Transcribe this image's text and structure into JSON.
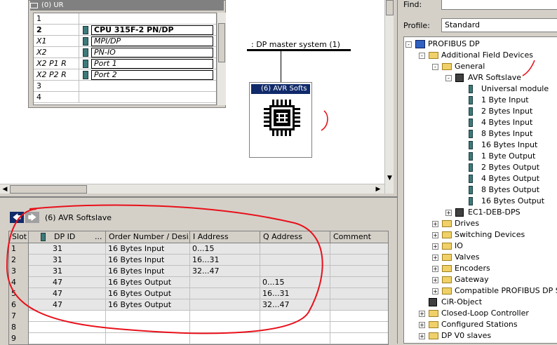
{
  "station": {
    "rack_title": "(0) UR",
    "rows": [
      {
        "slot": "1",
        "name": "",
        "italic": false,
        "bold": false,
        "icon": false
      },
      {
        "slot": "2",
        "name": "CPU 315F-2 PN/DP",
        "italic": false,
        "bold": true,
        "icon": true
      },
      {
        "slot": "X1",
        "name": "MPI/DP",
        "italic": true,
        "bold": false,
        "icon": true
      },
      {
        "slot": "X2",
        "name": "PN-IO",
        "italic": true,
        "bold": false,
        "icon": true
      },
      {
        "slot": "X2 P1 R",
        "name": "Port 1",
        "italic": true,
        "bold": false,
        "icon": true
      },
      {
        "slot": "X2 P2 R",
        "name": "Port 2",
        "italic": true,
        "bold": false,
        "icon": true
      },
      {
        "slot": "3",
        "name": "",
        "italic": false,
        "bold": false,
        "icon": false
      },
      {
        "slot": "4",
        "name": "",
        "italic": false,
        "bold": false,
        "icon": false
      }
    ],
    "dp_master_label": ": DP master system (1)",
    "slave_title": "(6) AVR Softs",
    "slave_icon": "chip-icon"
  },
  "detail": {
    "title": "(6)   AVR Softslave",
    "back_icon": "arrow-left-icon",
    "forward_icon": "arrow-right-icon",
    "columns": [
      "Slot",
      "DP ID",
      "...",
      "Order Number / Desi...",
      "I Address",
      "Q Address",
      "Comment"
    ],
    "rows": [
      {
        "slot": "1",
        "dpid": "31",
        "order": "16 Bytes Input",
        "i": "0...15",
        "q": "",
        "comment": ""
      },
      {
        "slot": "2",
        "dpid": "31",
        "order": "16 Bytes Input",
        "i": "16...31",
        "q": "",
        "comment": ""
      },
      {
        "slot": "3",
        "dpid": "31",
        "order": "16 Bytes Input",
        "i": "32...47",
        "q": "",
        "comment": ""
      },
      {
        "slot": "4",
        "dpid": "47",
        "order": "16 Bytes Output",
        "i": "",
        "q": "0...15",
        "comment": ""
      },
      {
        "slot": "5",
        "dpid": "47",
        "order": "16 Bytes Output",
        "i": "",
        "q": "16...31",
        "comment": ""
      },
      {
        "slot": "6",
        "dpid": "47",
        "order": "16 Bytes Output",
        "i": "",
        "q": "32...47",
        "comment": ""
      },
      {
        "slot": "7",
        "dpid": "",
        "order": "",
        "i": "",
        "q": "",
        "comment": ""
      },
      {
        "slot": "8",
        "dpid": "",
        "order": "",
        "i": "",
        "q": "",
        "comment": ""
      },
      {
        "slot": "9",
        "dpid": "",
        "order": "",
        "i": "",
        "q": "",
        "comment": ""
      }
    ]
  },
  "catalog": {
    "find_label": "Find:",
    "profile_label": "Profile:",
    "profile_value": "Standard",
    "tree": [
      {
        "label": "PROFIBUS DP",
        "level": 0,
        "exp": "-",
        "icon": "gsd"
      },
      {
        "label": "Additional Field Devices",
        "level": 1,
        "exp": "-",
        "icon": "folder"
      },
      {
        "label": "General",
        "level": 2,
        "exp": "-",
        "icon": "folder"
      },
      {
        "label": "AVR Softslave",
        "level": 3,
        "exp": "-",
        "icon": "device"
      },
      {
        "label": "Universal module",
        "level": 4,
        "exp": "",
        "icon": "module"
      },
      {
        "label": "1 Byte Input",
        "level": 4,
        "exp": "",
        "icon": "module"
      },
      {
        "label": "2 Bytes Input",
        "level": 4,
        "exp": "",
        "icon": "module"
      },
      {
        "label": "4 Bytes Input",
        "level": 4,
        "exp": "",
        "icon": "module"
      },
      {
        "label": "8 Bytes Input",
        "level": 4,
        "exp": "",
        "icon": "module"
      },
      {
        "label": "16 Bytes Input",
        "level": 4,
        "exp": "",
        "icon": "module"
      },
      {
        "label": "1 Byte Output",
        "level": 4,
        "exp": "",
        "icon": "module"
      },
      {
        "label": "2 Bytes Output",
        "level": 4,
        "exp": "",
        "icon": "module"
      },
      {
        "label": "4 Bytes Output",
        "level": 4,
        "exp": "",
        "icon": "module"
      },
      {
        "label": "8 Bytes Output",
        "level": 4,
        "exp": "",
        "icon": "module"
      },
      {
        "label": "16 Bytes Output",
        "level": 4,
        "exp": "",
        "icon": "module"
      },
      {
        "label": "EC1-DEB-DPS",
        "level": 3,
        "exp": "+",
        "icon": "device"
      },
      {
        "label": "Drives",
        "level": 2,
        "exp": "+",
        "icon": "folder"
      },
      {
        "label": "Switching Devices",
        "level": 2,
        "exp": "+",
        "icon": "folder"
      },
      {
        "label": "IO",
        "level": 2,
        "exp": "+",
        "icon": "folder"
      },
      {
        "label": "Valves",
        "level": 2,
        "exp": "+",
        "icon": "folder"
      },
      {
        "label": "Encoders",
        "level": 2,
        "exp": "+",
        "icon": "folder"
      },
      {
        "label": "Gateway",
        "level": 2,
        "exp": "+",
        "icon": "folder"
      },
      {
        "label": "Compatible PROFIBUS DP Sla",
        "level": 2,
        "exp": "+",
        "icon": "folder"
      },
      {
        "label": "CiR-Object",
        "level": 1,
        "exp": "",
        "icon": "device"
      },
      {
        "label": "Closed-Loop Controller",
        "level": 1,
        "exp": "+",
        "icon": "folder"
      },
      {
        "label": "Configured Stations",
        "level": 1,
        "exp": "+",
        "icon": "folder"
      },
      {
        "label": "DP V0 slaves",
        "level": 1,
        "exp": "+",
        "icon": "folder"
      }
    ]
  },
  "colors": {
    "annotation": "#e8101a",
    "title_bar": "#102a6a",
    "module": "#3d7a7a"
  }
}
